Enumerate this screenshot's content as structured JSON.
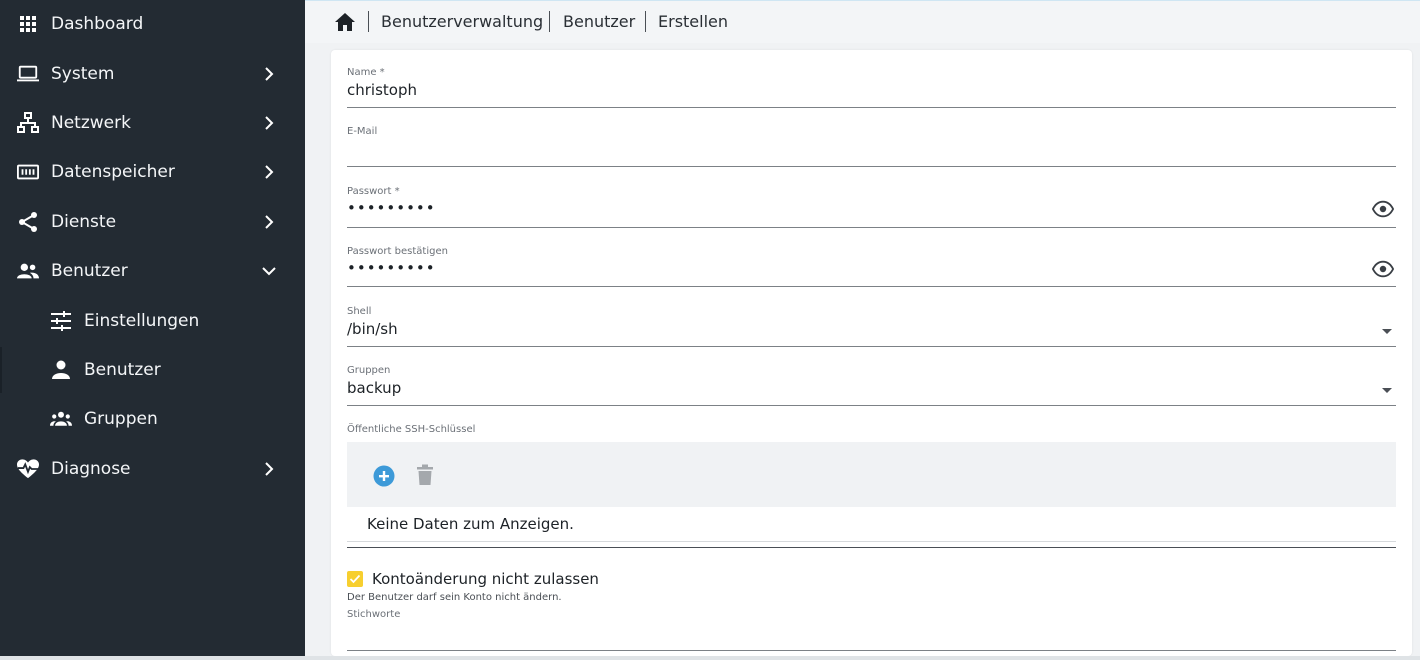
{
  "sidebar": {
    "items": [
      {
        "label": "Dashboard",
        "icon": "grid-icon"
      },
      {
        "label": "System",
        "icon": "laptop-icon"
      },
      {
        "label": "Netzwerk",
        "icon": "network-icon"
      },
      {
        "label": "Datenspeicher",
        "icon": "storage-icon"
      },
      {
        "label": "Dienste",
        "icon": "share-icon"
      },
      {
        "label": "Benutzer",
        "icon": "users-icon"
      },
      {
        "label": "Einstellungen",
        "icon": "tune-icon"
      },
      {
        "label": "Benutzer",
        "icon": "person-icon"
      },
      {
        "label": "Gruppen",
        "icon": "group-icon"
      },
      {
        "label": "Diagnose",
        "icon": "heart-pulse-icon"
      }
    ]
  },
  "breadcrumb": {
    "home_icon": "home-icon",
    "items": [
      "Benutzerverwaltung",
      "Benutzer",
      "Erstellen"
    ]
  },
  "form": {
    "name": {
      "label": "Name *",
      "value": "christoph"
    },
    "email": {
      "label": "E-Mail",
      "value": ""
    },
    "password": {
      "label": "Passwort *",
      "value": "•••••••••"
    },
    "password_confirm": {
      "label": "Passwort bestätigen",
      "value": "•••••••••"
    },
    "shell": {
      "label": "Shell",
      "value": "/bin/sh"
    },
    "groups": {
      "label": "Gruppen",
      "value": "backup"
    },
    "ssh_keys": {
      "label": "Öffentliche SSH-Schlüssel",
      "empty_text": "Keine Daten zum Anzeigen."
    },
    "disallow_account_change": {
      "label": "Kontoänderung nicht zulassen",
      "hint": "Der Benutzer darf sein Konto nicht ändern.",
      "checked": true
    },
    "tags": {
      "label": "Stichworte",
      "value": ""
    }
  },
  "colors": {
    "sidebar_bg": "#232b33",
    "accent_blue": "#3d9ad8",
    "checkbox_yellow": "#f7cf2f"
  }
}
